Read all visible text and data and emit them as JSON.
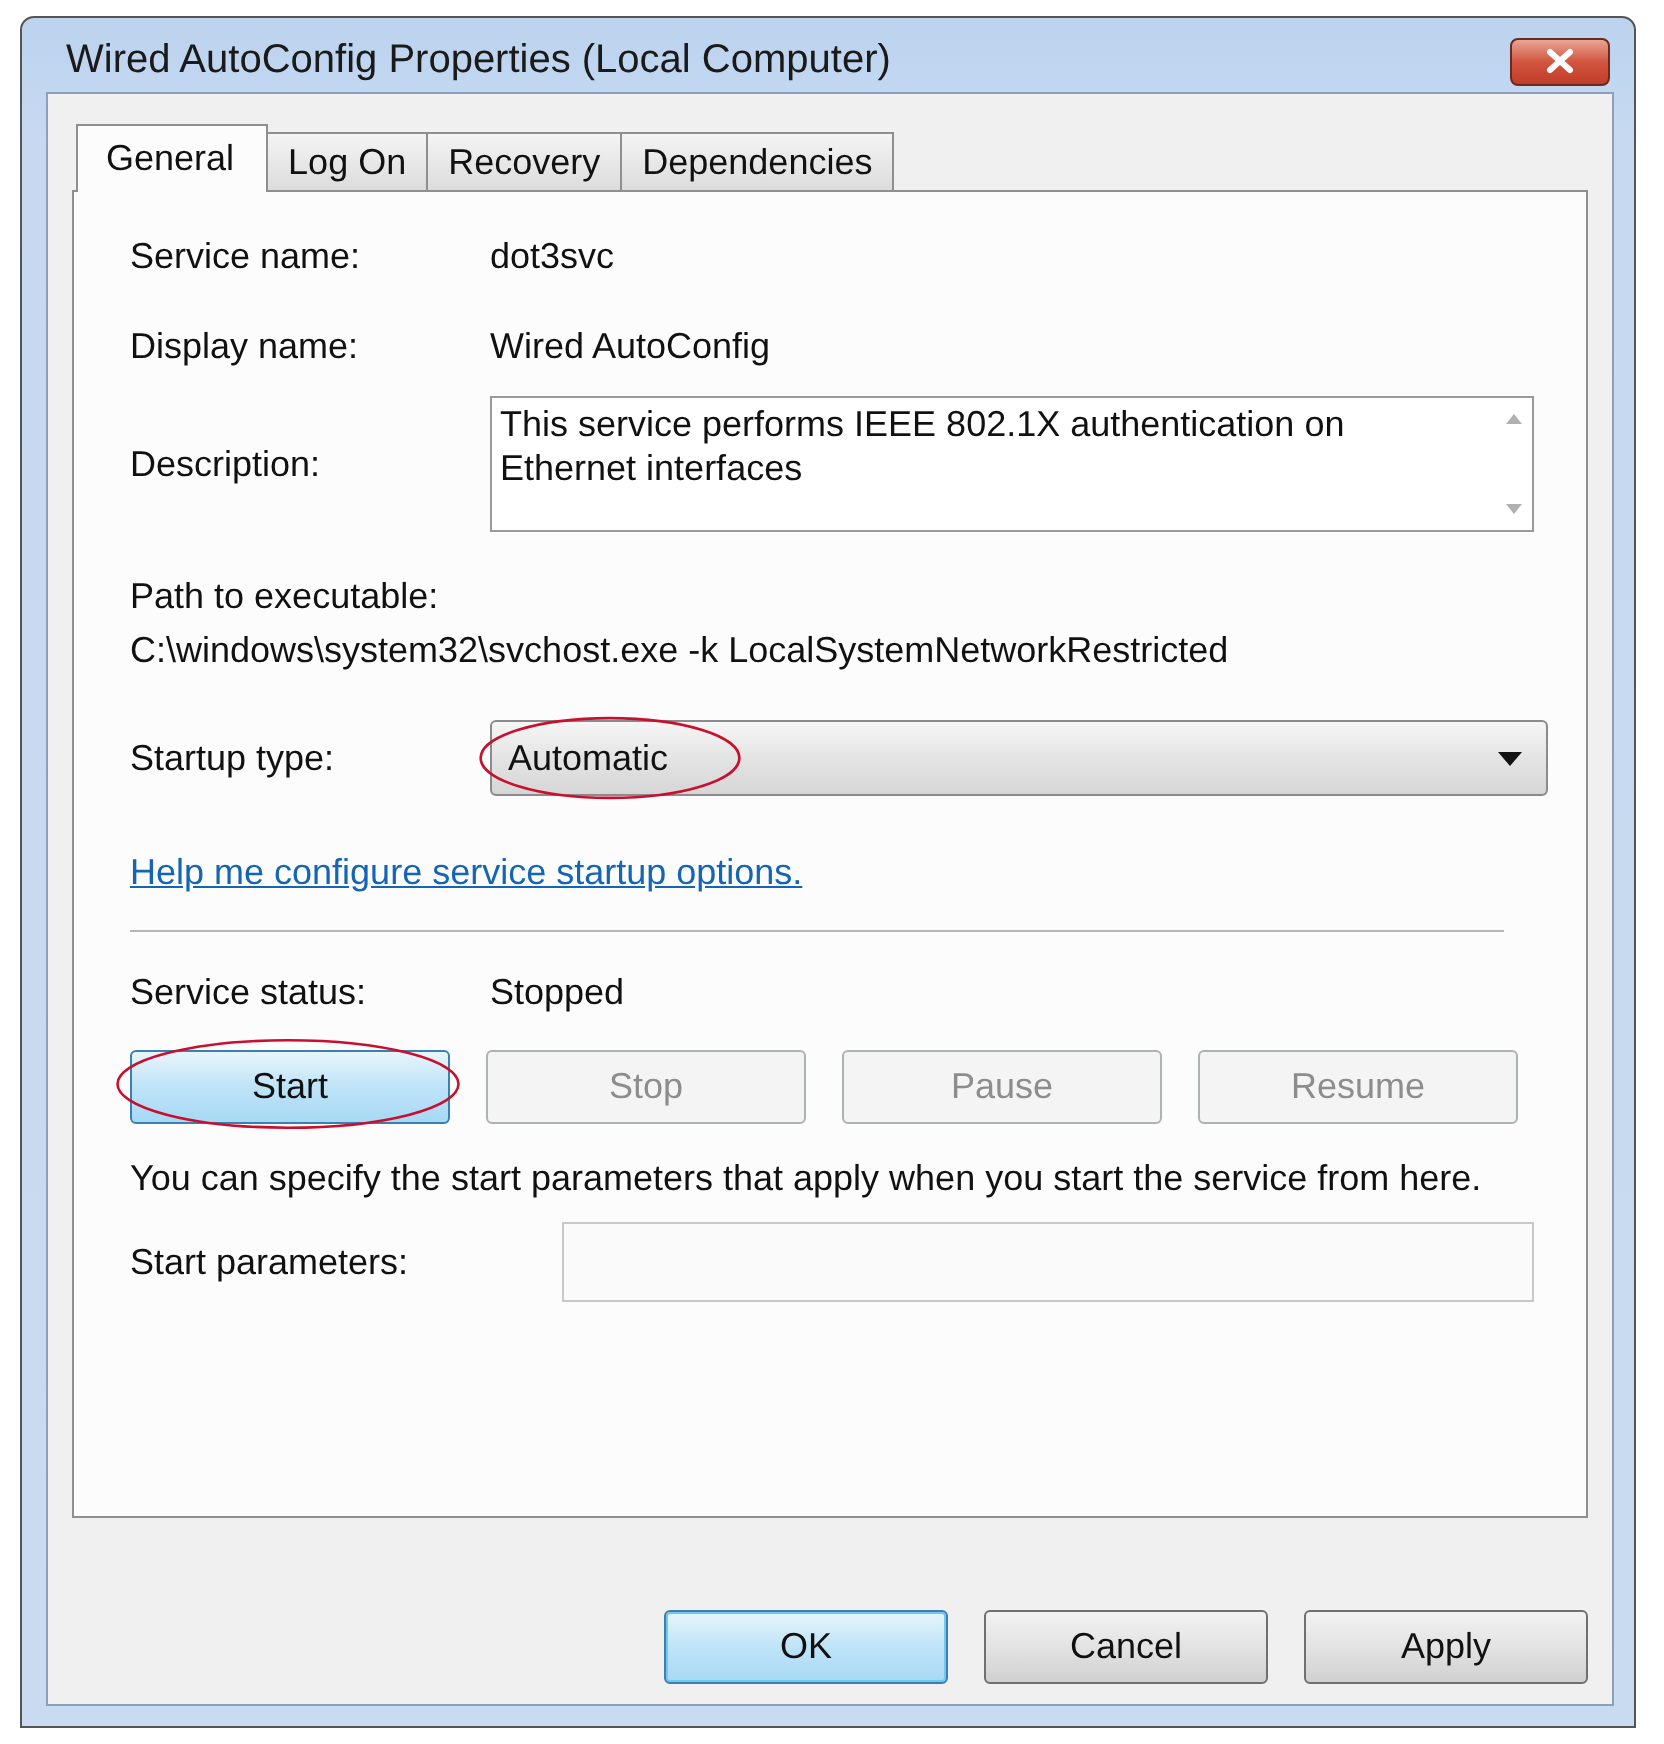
{
  "window": {
    "title": "Wired AutoConfig Properties (Local Computer)"
  },
  "tabs": [
    {
      "label": "General",
      "selected": true
    },
    {
      "label": "Log On",
      "selected": false
    },
    {
      "label": "Recovery",
      "selected": false
    },
    {
      "label": "Dependencies",
      "selected": false
    }
  ],
  "general": {
    "service_name": {
      "label": "Service name:",
      "value": "dot3svc"
    },
    "display_name": {
      "label": "Display name:",
      "value": "Wired AutoConfig"
    },
    "description": {
      "label": "Description:",
      "value": "This service performs IEEE 802.1X authentication on Ethernet interfaces"
    },
    "path": {
      "label": "Path to executable:",
      "value": "C:\\windows\\system32\\svchost.exe -k LocalSystemNetworkRestricted"
    },
    "startup_type": {
      "label": "Startup type:",
      "value": "Automatic",
      "highlighted": true
    },
    "help_link": "Help me configure service startup options.",
    "service_status": {
      "label": "Service status:",
      "value": "Stopped"
    },
    "service_buttons": [
      {
        "label": "Start",
        "disabled": false,
        "highlighted": true
      },
      {
        "label": "Stop",
        "disabled": true,
        "highlighted": false
      },
      {
        "label": "Pause",
        "disabled": true,
        "highlighted": false
      },
      {
        "label": "Resume",
        "disabled": true,
        "highlighted": false
      }
    ],
    "hint": "You can specify the start parameters that apply when you start the service from here.",
    "start_parameters": {
      "label": "Start parameters:",
      "disabled": true
    }
  },
  "buttons": [
    {
      "label": "OK",
      "default": true
    },
    {
      "label": "Cancel",
      "default": false
    },
    {
      "label": "Apply",
      "default": false
    }
  ]
}
